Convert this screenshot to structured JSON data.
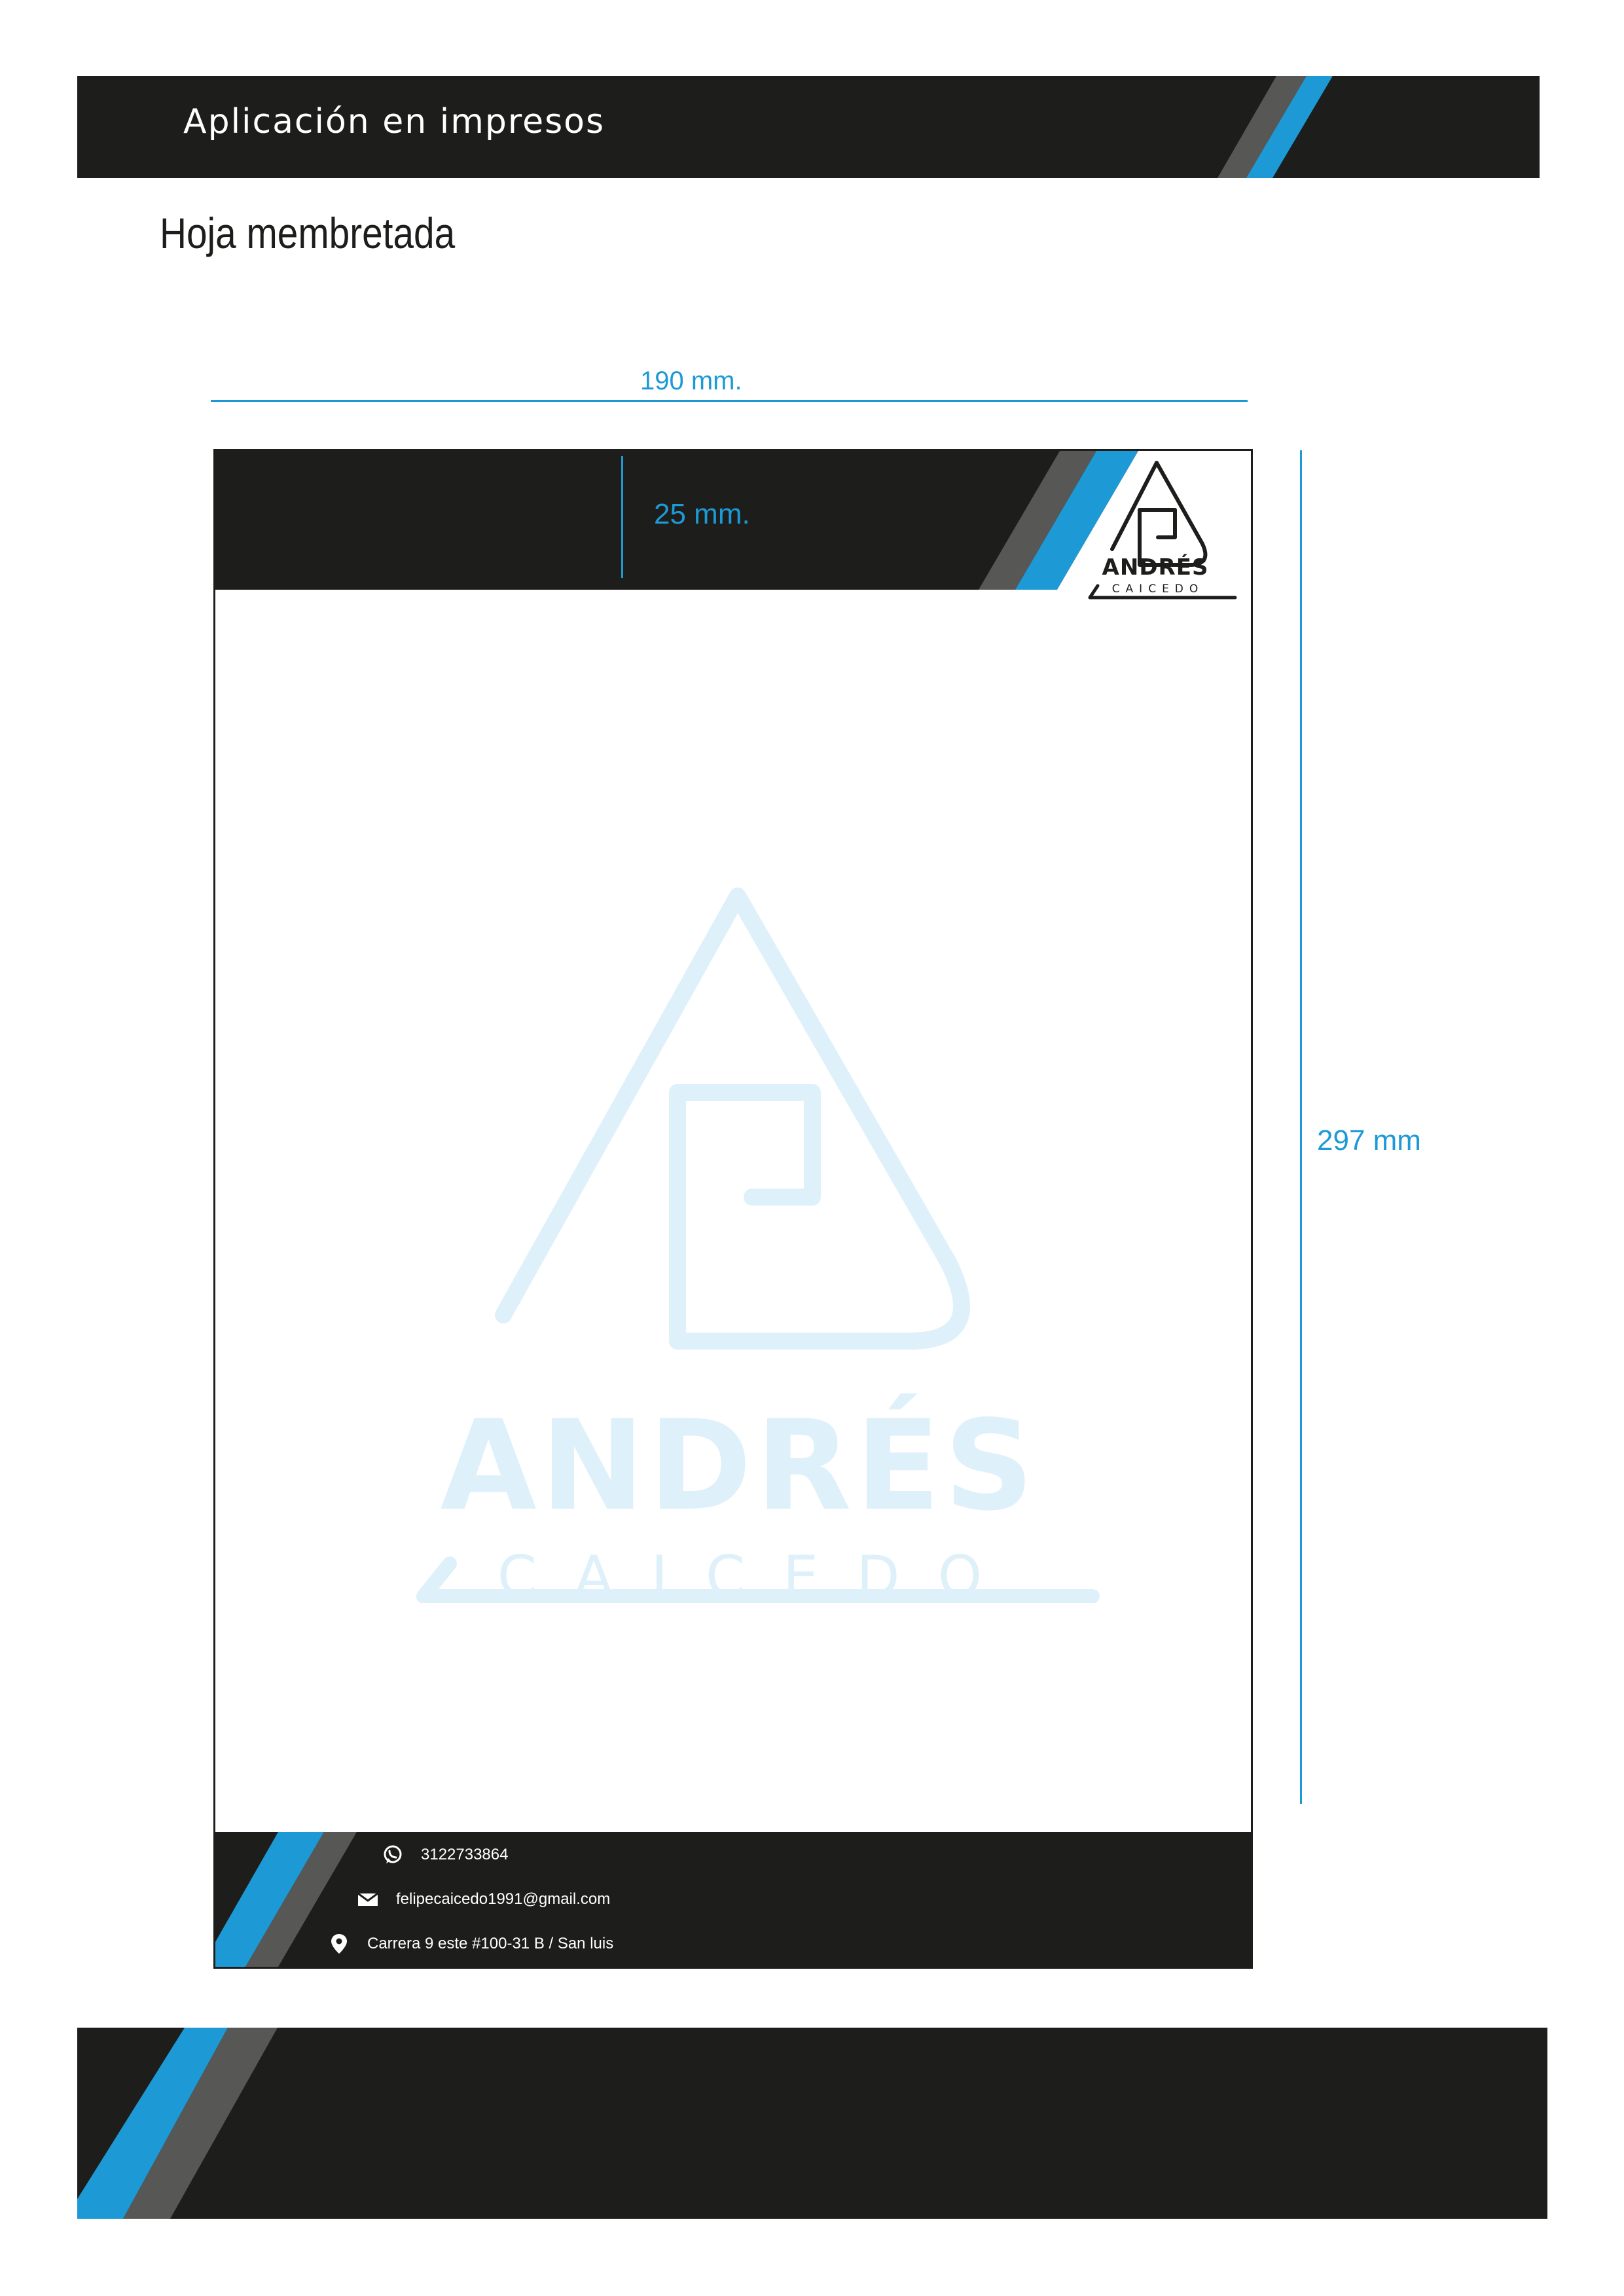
{
  "banner": {
    "title": "Aplicación en impresos"
  },
  "section": {
    "title": "Hoja membretada"
  },
  "dimensions": {
    "width": "190 mm.",
    "header": "25 mm.",
    "height": "297 mm"
  },
  "logo": {
    "brand": "ANDRÉS",
    "sub": "CAICEDO"
  },
  "contact": {
    "phone": "3122733864",
    "email": "felipecaicedo1991@gmail.com",
    "address": "Carrera 9 este #100-31 B / San luis"
  },
  "colors": {
    "dark": "#1d1d1b",
    "blue": "#1d9ad6",
    "gray": "#575756",
    "watermark": "#def0fa"
  },
  "icons": [
    "whatsapp-icon",
    "mail-icon",
    "location-pin-icon"
  ]
}
